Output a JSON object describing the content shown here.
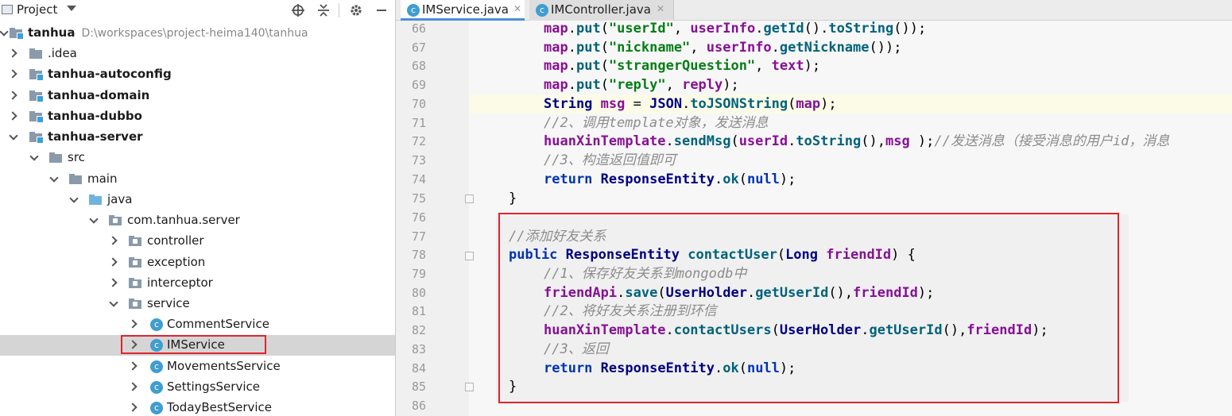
{
  "project_pane": {
    "title": "Project",
    "root": {
      "name": "tanhua",
      "path": "D:\\workspaces\\project-heima140\\tanhua"
    },
    "tree": [
      {
        "label": ".idea",
        "bold": false
      },
      {
        "label": "tanhua-autoconfig",
        "bold": true
      },
      {
        "label": "tanhua-domain",
        "bold": true
      },
      {
        "label": "tanhua-dubbo",
        "bold": true
      },
      {
        "label": "tanhua-server",
        "bold": true
      },
      {
        "label": "src",
        "bold": false
      },
      {
        "label": "main",
        "bold": false
      },
      {
        "label": "java",
        "bold": false
      },
      {
        "label": "com.tanhua.server",
        "bold": false
      },
      {
        "label": "controller",
        "bold": false
      },
      {
        "label": "exception",
        "bold": false
      },
      {
        "label": "interceptor",
        "bold": false
      },
      {
        "label": "service",
        "bold": false
      },
      {
        "label": "CommentService",
        "bold": false
      },
      {
        "label": "IMService",
        "bold": false
      },
      {
        "label": "MovementsService",
        "bold": false
      },
      {
        "label": "SettingsService",
        "bold": false
      },
      {
        "label": "TodayBestService",
        "bold": false
      }
    ],
    "selected": "IMService",
    "icons": [
      "crosshair-icon",
      "collapse-icon",
      "gear-icon",
      "minimize-icon"
    ]
  },
  "editor": {
    "tabs": [
      {
        "label": "IMService.java",
        "active": true
      },
      {
        "label": "IMController.java",
        "active": false
      }
    ],
    "line_numbers": [
      "66",
      "67",
      "68",
      "69",
      "70",
      "71",
      "72",
      "73",
      "74",
      "75",
      "76",
      "77",
      "78",
      "79",
      "80",
      "81",
      "82",
      "83",
      "84",
      "85",
      "86"
    ],
    "lines": [
      "map.put(\"userId\", userInfo.getId().toString());",
      "map.put(\"nickname\", userInfo.getNickname());",
      "map.put(\"strangerQuestion\", text);",
      "map.put(\"reply\", reply);",
      "String msg = JSON.toJSONString(map);",
      "//2、调用template对象，发送消息",
      "huanXinTemplate.sendMsg(userId.toString(),msg );//发送消息（接受消息的用户id，消息",
      "//3、构造返回值即可",
      "return ResponseEntity.ok(null);",
      "}",
      "",
      "//添加好友关系",
      "public ResponseEntity contactUser(Long friendId) {",
      "//1、保存好友关系到mongodb中",
      "friendApi.save(UserHolder.getUserId(),friendId);",
      "//2、将好友关系注册到环信",
      "huanXinTemplate.contactUsers(UserHolder.getUserId(),friendId);",
      "//3、返回",
      "return ResponseEntity.ok(null);",
      "}",
      ""
    ],
    "highlight_color": "#e0242c"
  }
}
